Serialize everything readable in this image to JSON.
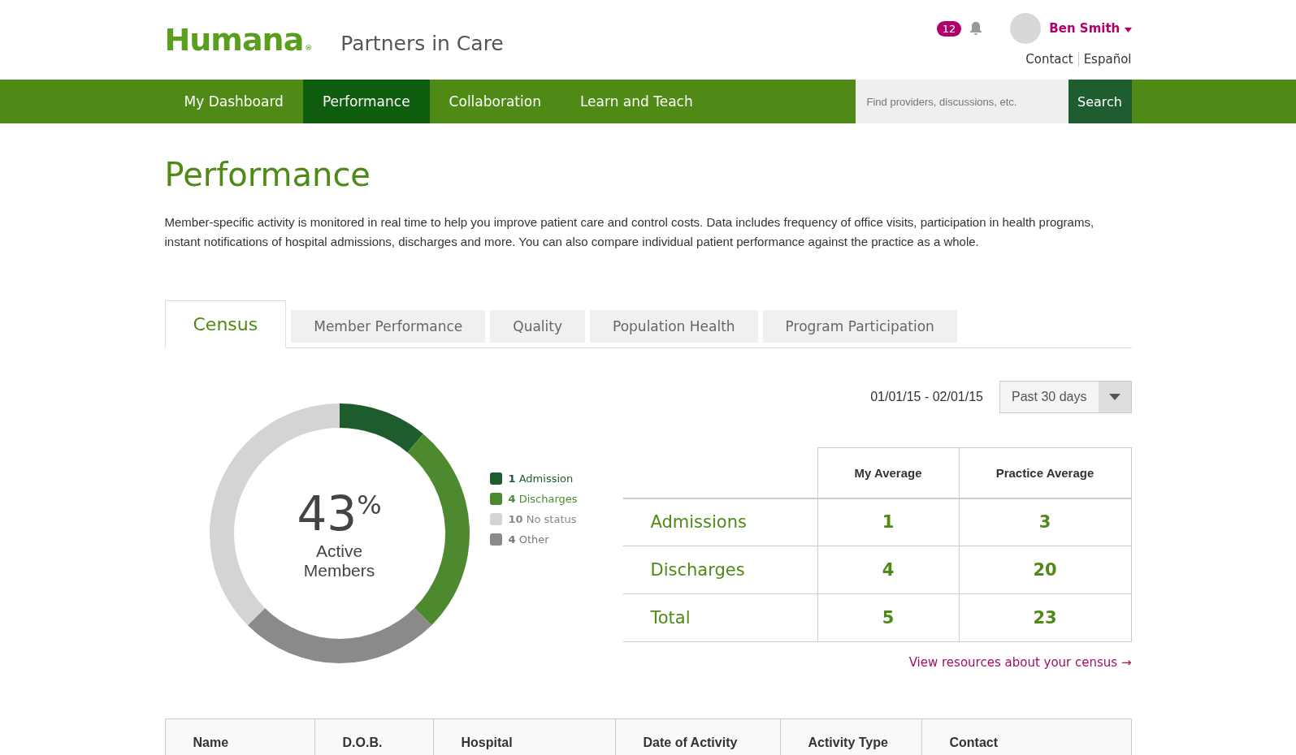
{
  "header": {
    "logo": "Humana",
    "logo_mark": "®",
    "subtitle": "Partners in Care",
    "notifications": "12",
    "user": "Ben Smith",
    "links": [
      "Contact",
      "Español"
    ]
  },
  "nav": {
    "items": [
      {
        "label": "My Dashboard",
        "selected": false
      },
      {
        "label": "Performance",
        "selected": true
      },
      {
        "label": "Collaboration",
        "selected": false
      },
      {
        "label": "Learn and Teach",
        "selected": false
      }
    ],
    "search": {
      "placeholder": "Find providers, discussions, etc.",
      "button": "Search"
    }
  },
  "page": {
    "title": "Performance",
    "intro": "Member-specific activity is monitored in real time to help you improve patient care and control costs. Data includes frequency of office visits, participation in health programs, instant notifications of hospital admissions, discharges and more. You can also compare individual patient performance against the practice as a whole."
  },
  "tabs": [
    {
      "label": "Census",
      "selected": true
    },
    {
      "label": "Member Performance",
      "selected": false
    },
    {
      "label": "Quality",
      "selected": false
    },
    {
      "label": "Population Health",
      "selected": false
    },
    {
      "label": "Program Participation",
      "selected": false
    }
  ],
  "census": {
    "date_range": "01/01/15 - 02/01/15",
    "period": "Past 30 days",
    "center": {
      "value": "43",
      "unit": "%",
      "label": "Active Members"
    },
    "legend": [
      {
        "count": "1",
        "label": "Admission",
        "color": "#1e5c2e"
      },
      {
        "count": "4",
        "label": "Discharges",
        "color": "#4d8a2f"
      },
      {
        "count": "10",
        "label": "No status",
        "color": "#d4d4d4"
      },
      {
        "count": "4",
        "label": "Other",
        "color": "#8a8a8a"
      }
    ],
    "table": {
      "columns": [
        "My Average",
        "Practice Average"
      ],
      "rows": [
        {
          "label": "Admissions",
          "values": [
            "1",
            "3"
          ]
        },
        {
          "label": "Discharges",
          "values": [
            "4",
            "20"
          ]
        },
        {
          "label": "Total",
          "values": [
            "5",
            "23"
          ]
        }
      ]
    },
    "link": "View resources about your census →"
  },
  "activity_table": {
    "columns": [
      "Name",
      "D.O.B.",
      "Hospital",
      "Date of Activity",
      "Activity Type",
      "Contact"
    ]
  }
}
